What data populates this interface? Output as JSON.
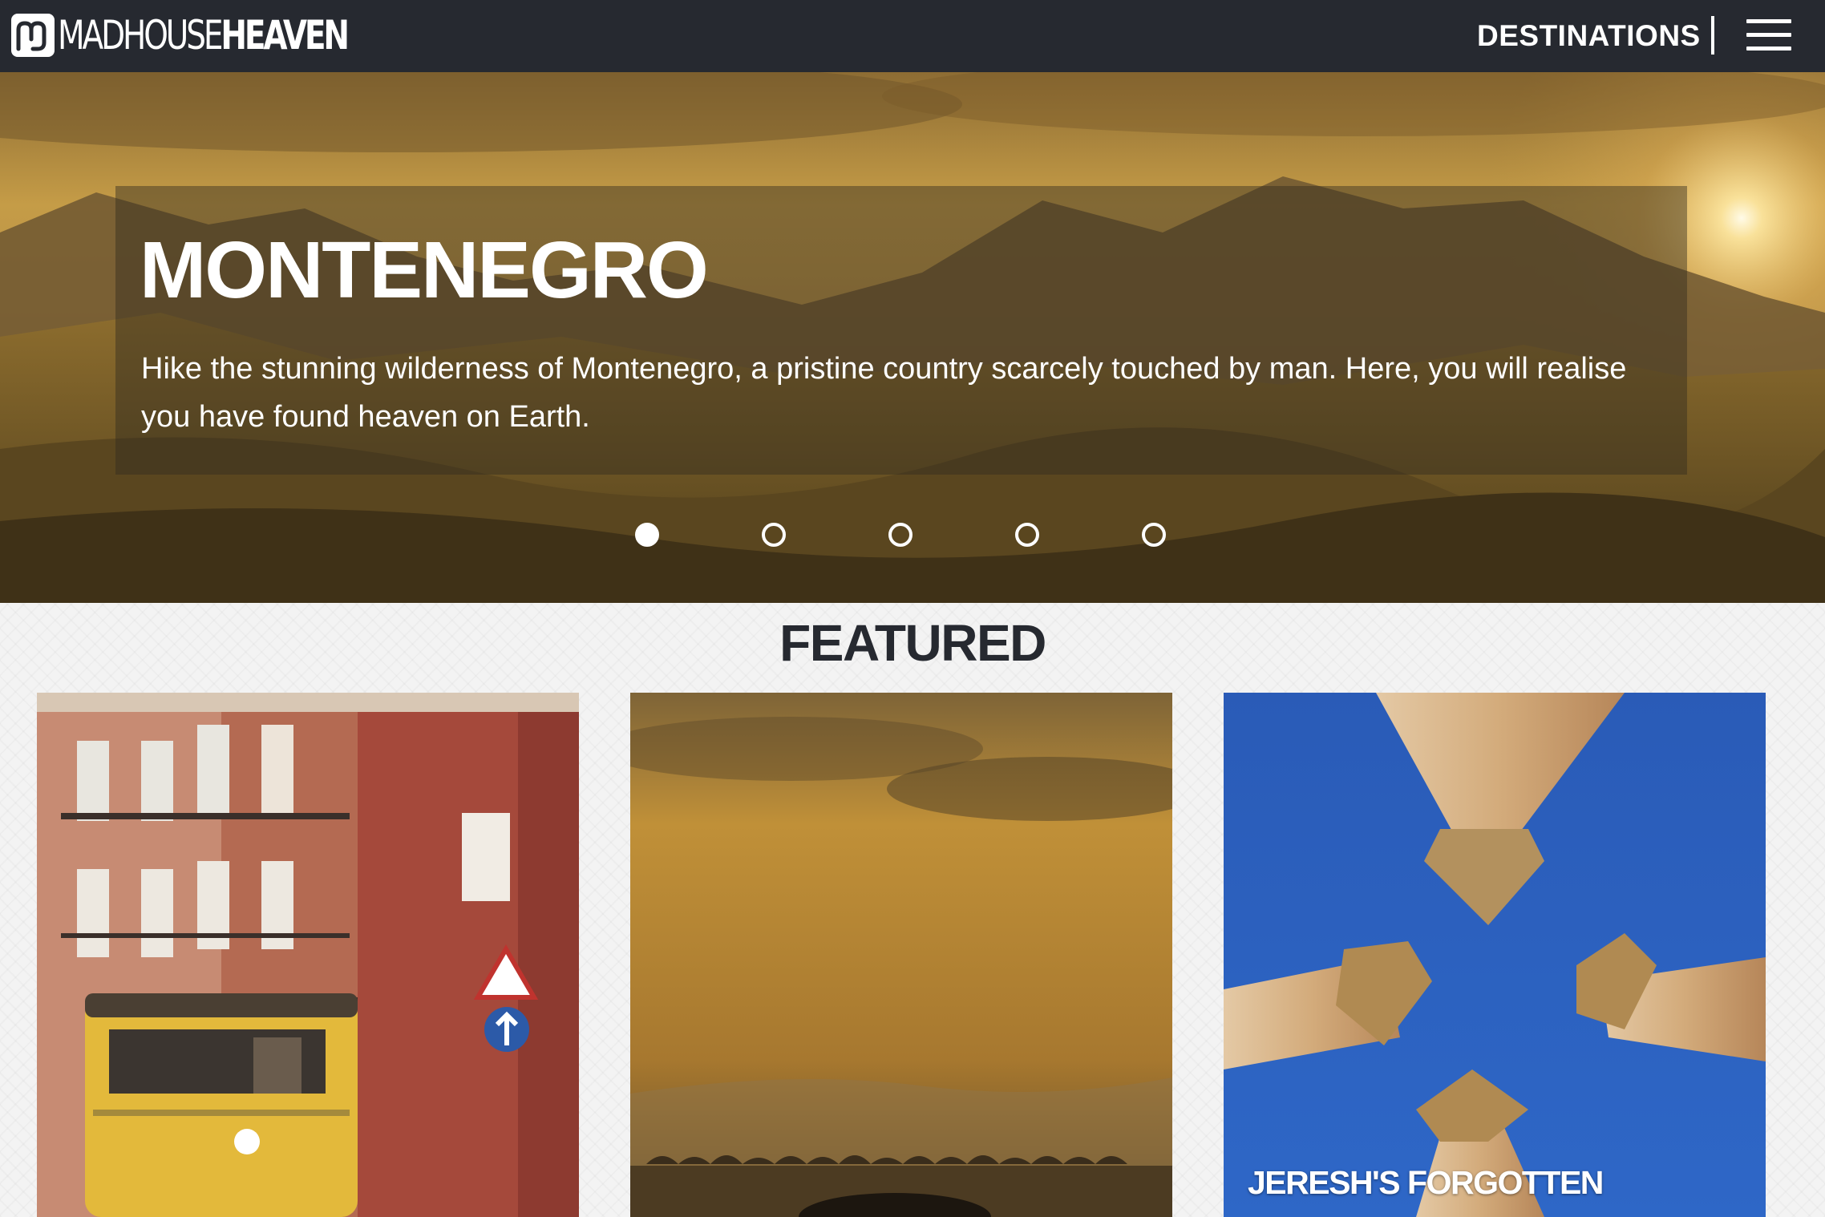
{
  "brand": {
    "name_light": "MADHOUSE",
    "name_bold": "HEAVEN"
  },
  "nav": {
    "destinations_label": "DESTINATIONS",
    "menu_icon": "hamburger-menu-icon"
  },
  "hero": {
    "title": "MONTENEGRO",
    "description": "Hike the stunning wilderness of Montenegro, a pristine country scarcely touched by man. Here, you will realise you have found heaven on Earth.",
    "slide_count": 5,
    "active_slide": 1
  },
  "featured": {
    "heading": "FEATURED",
    "cards": [
      {
        "caption": ""
      },
      {
        "caption": ""
      },
      {
        "caption": "JERESH'S FORGOTTEN"
      }
    ]
  },
  "colors": {
    "nav_bg": "#262930",
    "text_dark": "#262930",
    "hero_sky": "#c39a45",
    "sky_blue": "#2d62bf"
  }
}
